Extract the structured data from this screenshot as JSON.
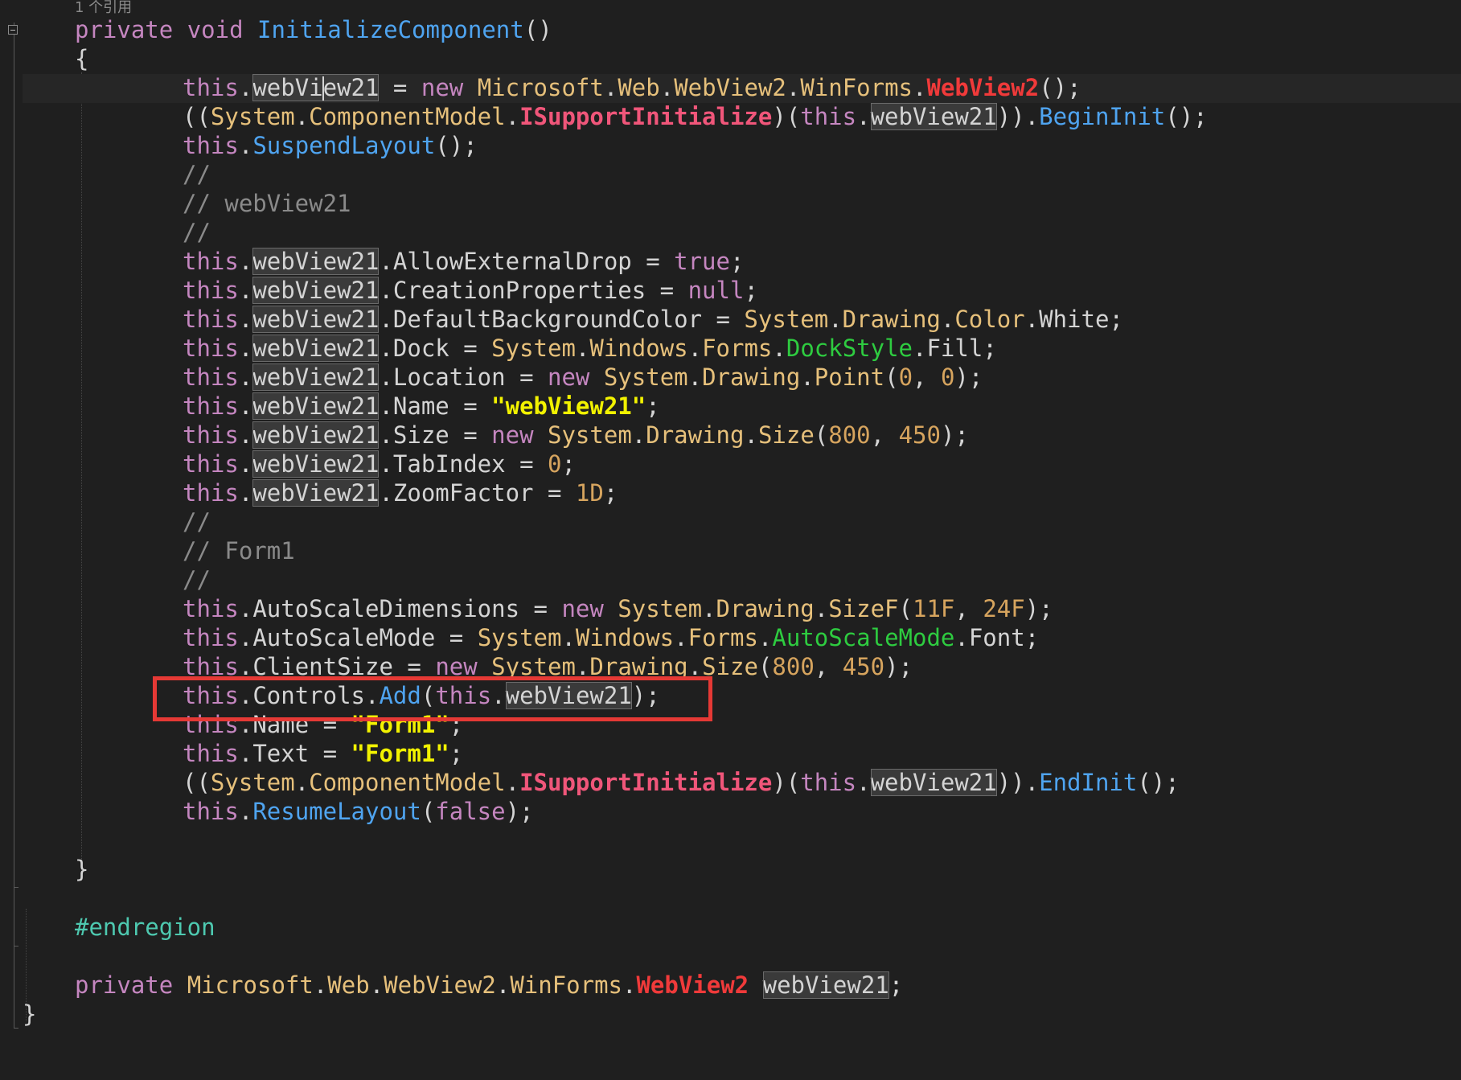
{
  "codelens": {
    "references": "1 个引用"
  },
  "annotation": {
    "color": "#e53935"
  },
  "tokens": {
    "this": "this",
    "dot": ".",
    "semi": ";",
    "private": "private",
    "void": "void",
    "new": "new",
    "true": "true",
    "null": "null",
    "false": "false",
    "webView21": "webView21",
    "Microsoft": "Microsoft",
    "Web": "Web",
    "WebView2": "WebView2",
    "WinForms": "WinForms",
    "System": "System",
    "Drawing": "Drawing",
    "Windows": "Windows",
    "Forms": "Forms",
    "ComponentModel": "ComponentModel",
    "ISupportInitialize": "ISupportInitialize"
  },
  "lines": {
    "l1": {
      "method": "InitializeComponent",
      "parens": "()"
    },
    "l2": {
      "text": "{"
    },
    "l3": {
      "part_a": "webVi",
      "part_b": "ew21",
      "assign": " = ",
      "end": "();"
    },
    "l4": {
      "open": "((",
      "close_cast": ")(",
      "close_args": "))",
      "call": "BeginInit",
      "end": "();"
    },
    "l5": {
      "call": "SuspendLayout",
      "end": "();"
    },
    "l6": {
      "text": "//"
    },
    "l7": {
      "text": "// webView21"
    },
    "l8": {
      "text": "//"
    },
    "l9": {
      "prop": "AllowExternalDrop",
      "assign": " = "
    },
    "l10": {
      "prop": "CreationProperties",
      "assign": " = "
    },
    "l11": {
      "prop": "DefaultBackgroundColor",
      "assign": " = ",
      "type": "Color",
      "member": "White"
    },
    "l12": {
      "prop": "Dock",
      "assign": " = ",
      "enum": "DockStyle",
      "member": "Fill"
    },
    "l13": {
      "prop": "Location",
      "assign": " = ",
      "type": "Point",
      "open": "(",
      "n1": "0",
      "comma": ", ",
      "n2": "0",
      "end": ");"
    },
    "l14": {
      "prop": "Name",
      "assign": " = ",
      "value": "\"webView21\""
    },
    "l15": {
      "prop": "Size",
      "assign": " = ",
      "type": "Size",
      "open": "(",
      "n1": "800",
      "comma": ", ",
      "n2": "450",
      "end": ");"
    },
    "l16": {
      "prop": "TabIndex",
      "assign": " = ",
      "n1": "0"
    },
    "l17": {
      "prop": "ZoomFactor",
      "assign": " = ",
      "n1": "1D"
    },
    "l18": {
      "text": "//"
    },
    "l19": {
      "text": "// Form1"
    },
    "l20": {
      "text": "//"
    },
    "l21": {
      "prop": "AutoScaleDimensions",
      "assign": " = ",
      "type": "SizeF",
      "open": "(",
      "n1": "11F",
      "comma": ", ",
      "n2": "24F",
      "end": ");"
    },
    "l22": {
      "prop": "AutoScaleMode",
      "assign": " = ",
      "enum": "AutoScaleMode",
      "member": "Font"
    },
    "l23": {
      "prop": "ClientSize",
      "assign": " = ",
      "type": "Size",
      "open": "(",
      "n1": "800",
      "comma": ", ",
      "n2": "450",
      "end": ");"
    },
    "l24": {
      "prop": "Controls",
      "call": "Add",
      "open": "(",
      "end": ");"
    },
    "l25": {
      "prop": "Name",
      "assign": " = ",
      "value": "\"Form1\""
    },
    "l26": {
      "prop": "Text",
      "assign": " = ",
      "value": "\"Form1\""
    },
    "l27": {
      "open": "((",
      "close_cast": ")(",
      "close_args": "))",
      "call": "EndInit",
      "end": "();"
    },
    "l28": {
      "call": "ResumeLayout",
      "open": "(",
      "end": ");"
    },
    "l29": {
      "text": "}"
    },
    "l30": {
      "text": "#endregion"
    },
    "l31": {
      "sp": " "
    },
    "l32": {
      "text": "}"
    }
  }
}
